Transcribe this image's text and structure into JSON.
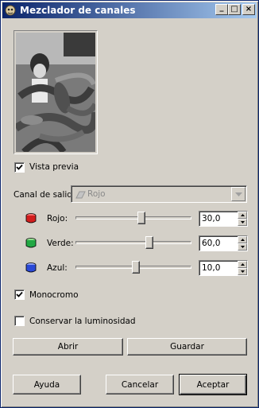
{
  "window": {
    "title": "Mezclador de canales"
  },
  "titlebar": {
    "minimize": "_",
    "maximize": "□",
    "close": "×"
  },
  "preview": {
    "label": "Vista previa",
    "checked": true
  },
  "output_channel": {
    "label": "Canal de salida:",
    "value": "Rojo",
    "enabled": false
  },
  "channels": [
    {
      "label": "Rojo:",
      "value": "30,0",
      "color": "#d21e1e",
      "level_percent": 30
    },
    {
      "label": "Verde:",
      "value": "60,0",
      "color": "#22a844",
      "level_percent": 60
    },
    {
      "label": "Azul:",
      "value": "10,0",
      "color": "#2a49d6",
      "level_percent": 10
    }
  ],
  "monochrome": {
    "label": "Monocromo",
    "checked": true
  },
  "preserve_luminosity": {
    "label": "Conservar la luminosidad",
    "checked": false
  },
  "buttons": {
    "open": "Abrir",
    "save": "Guardar",
    "help": "Ayuda",
    "cancel": "Cancelar",
    "accept": "Aceptar"
  },
  "colors": {
    "titlebar_start": "#0a246a",
    "titlebar_end": "#a6caf0",
    "face": "#d4d0c8"
  }
}
